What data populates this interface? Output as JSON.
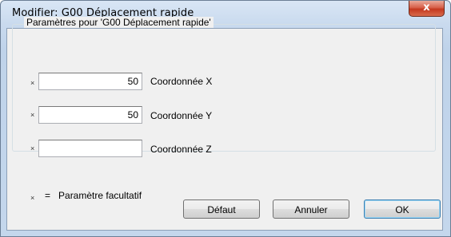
{
  "window": {
    "title": "Modifier: G00 Déplacement rapide",
    "close_glyph": "x"
  },
  "group": {
    "legend": "Paramètres pour 'G00 Déplacement rapide'"
  },
  "fields": [
    {
      "optional_mark": "×",
      "value": "50",
      "label": "Coordonnée X"
    },
    {
      "optional_mark": "×",
      "value": "50",
      "label": "Coordonnée Y"
    },
    {
      "optional_mark": "×",
      "value": "",
      "label": "Coordonnée Z"
    }
  ],
  "legend_note": {
    "mark": "×",
    "text": "=   Paramètre facultatif"
  },
  "buttons": {
    "default_label": "Défaut",
    "cancel_label": "Annuler",
    "ok_label": "OK"
  },
  "colors": {
    "close_button": "#c94a32",
    "accent_focus": "#3c7fb1"
  }
}
